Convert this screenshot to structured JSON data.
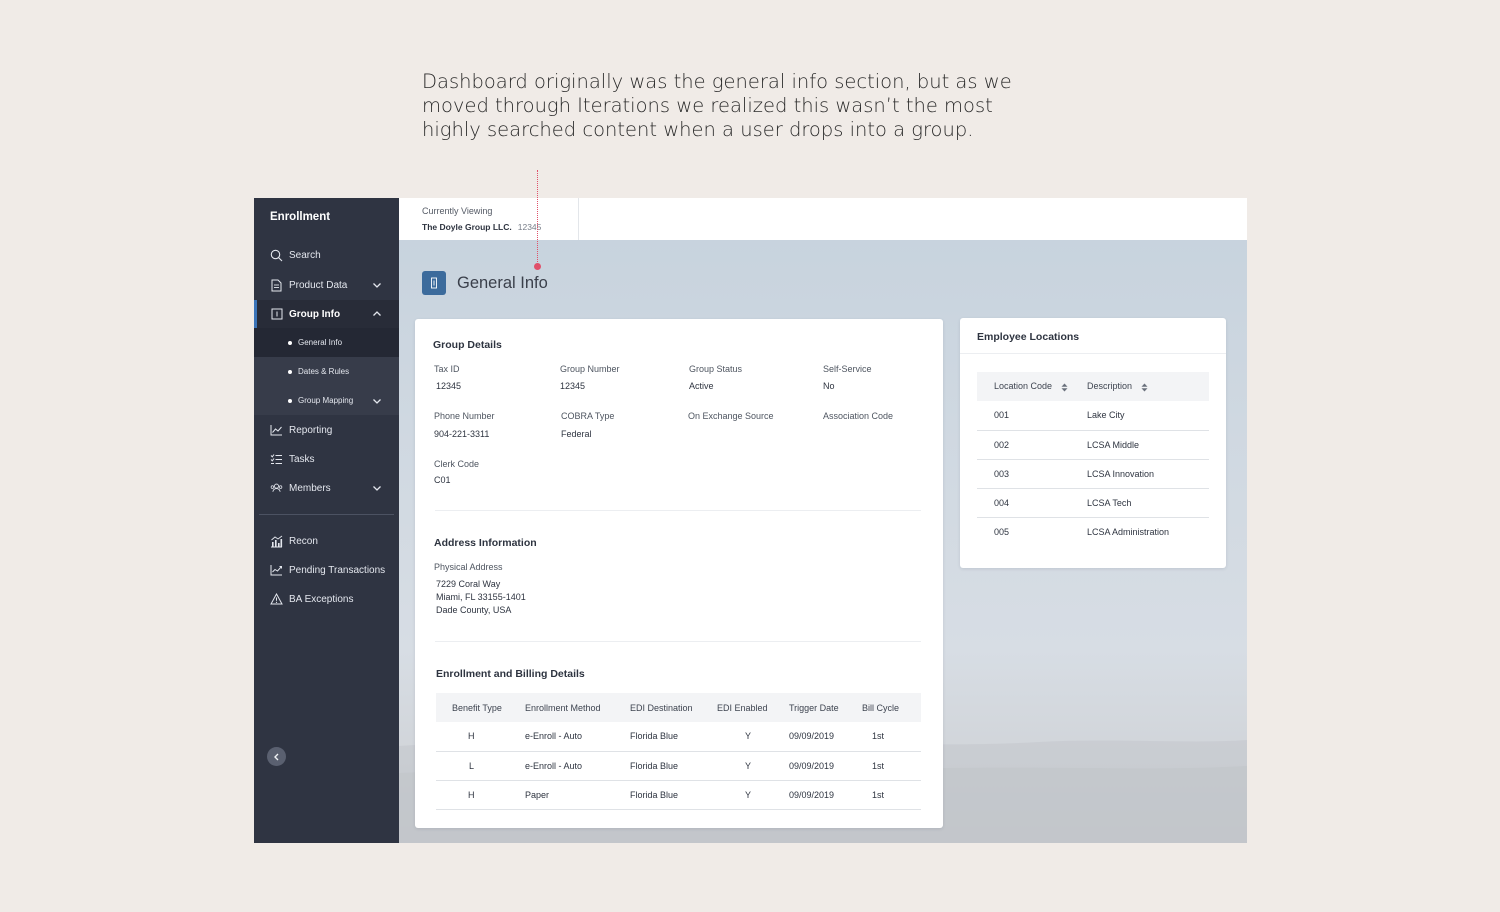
{
  "annotation": {
    "lines": [
      "Dashboard originally was the general info section, but as we",
      "moved through Iterations we realized this wasn’t the most",
      "highly searched content when a user drops into a group."
    ]
  },
  "sidebar": {
    "title": "Enrollment",
    "items": [
      {
        "label": "Search",
        "icon": "search-icon"
      },
      {
        "label": "Product Data",
        "icon": "document-icon"
      },
      {
        "label": "Group Info",
        "icon": "info-icon"
      },
      {
        "label": "Reporting",
        "icon": "chart-line-icon"
      },
      {
        "label": "Tasks",
        "icon": "checklist-icon"
      },
      {
        "label": "Members",
        "icon": "members-icon"
      },
      {
        "label": "Recon",
        "icon": "bar-chart-icon"
      },
      {
        "label": "Pending Transactions",
        "icon": "trend-icon"
      },
      {
        "label": "BA Exceptions",
        "icon": "warning-icon"
      }
    ],
    "sub_items": [
      {
        "label": "General Info"
      },
      {
        "label": "Dates & Rules"
      },
      {
        "label": "Group Mapping"
      }
    ]
  },
  "topbar": {
    "label": "Currently Viewing",
    "group_name": "The Doyle Group LLC.",
    "group_id": "12345"
  },
  "page": {
    "title": "General Info",
    "icon": "info-icon"
  },
  "group_details": {
    "title": "Group Details",
    "fields": [
      {
        "label": "Tax ID",
        "value": "12345"
      },
      {
        "label": "Group Number",
        "value": "12345"
      },
      {
        "label": "Group Status",
        "value": "Active"
      },
      {
        "label": "Self-Service",
        "value": "No"
      },
      {
        "label": "Phone Number",
        "value": "904-221-3311"
      },
      {
        "label": "COBRA Type",
        "value": "Federal"
      },
      {
        "label": "On Exchange Source",
        "value": ""
      },
      {
        "label": "Association Code",
        "value": ""
      },
      {
        "label": "Clerk Code",
        "value": "C01"
      }
    ]
  },
  "address": {
    "title": "Address Information",
    "label": "Physical Address",
    "lines": [
      "7229 Coral Way",
      "Miami, FL 33155-1401",
      "Dade County, USA"
    ]
  },
  "billing": {
    "title": "Enrollment and Billing Details",
    "columns": [
      "Benefit Type",
      "Enrollment Method",
      "EDI Destination",
      "EDI Enabled",
      "Trigger Date",
      "Bill Cycle"
    ],
    "rows": [
      [
        "H",
        "e-Enroll - Auto",
        "Florida Blue",
        "Y",
        "09/09/2019",
        "1st"
      ],
      [
        "L",
        "e-Enroll - Auto",
        "Florida Blue",
        "Y",
        "09/09/2019",
        "1st"
      ],
      [
        "H",
        "Paper",
        "Florida Blue",
        "Y",
        "09/09/2019",
        "1st"
      ]
    ]
  },
  "locations": {
    "title": "Employee Locations",
    "columns": [
      "Location Code",
      "Description"
    ],
    "rows": [
      [
        "001",
        "Lake City"
      ],
      [
        "002",
        "LCSA Middle"
      ],
      [
        "003",
        "LCSA Innovation"
      ],
      [
        "004",
        "LCSA Tech"
      ],
      [
        "005",
        "LCSA Administration"
      ]
    ]
  },
  "colors": {
    "sidebar_bg": "#2f3442",
    "accent": "#3b74b8",
    "page_bg": "#f0ebe7",
    "annotation_marker": "#e0506a"
  }
}
